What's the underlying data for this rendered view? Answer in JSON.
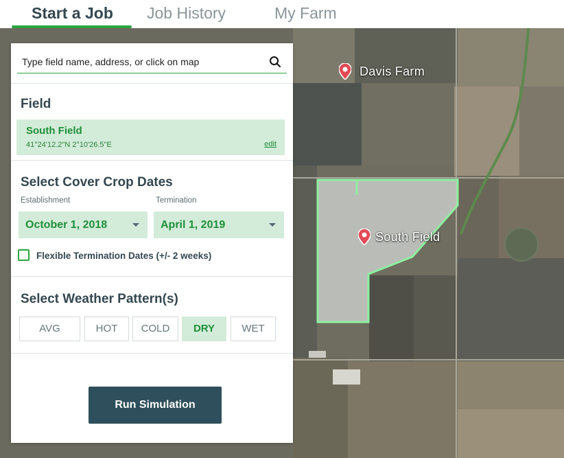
{
  "tabs": [
    {
      "label": "Start a Job",
      "active": true
    },
    {
      "label": "Job History",
      "active": false
    },
    {
      "label": "My Farm",
      "active": false
    }
  ],
  "search": {
    "placeholder": "Type field name, address, or click on map",
    "icon": "search-icon"
  },
  "field_section": {
    "title": "Field",
    "selected": {
      "name": "South Field",
      "coords": "41°24'12.2\"N 2°10'26.5\"E",
      "edit_label": "edit"
    }
  },
  "cover_crop": {
    "title": "Select Cover Crop Dates",
    "establishment_label": "Establishment",
    "establishment_value": "October 1, 2018",
    "termination_label": "Termination",
    "termination_value": "April 1, 2019",
    "flexible_label": "Flexible Termination Dates (+/- 2 weeks)",
    "flexible_checked": false
  },
  "weather": {
    "title": "Select Weather Pattern(s)",
    "options": [
      {
        "label": "AVG",
        "selected": false
      },
      {
        "label": "HOT",
        "selected": false
      },
      {
        "label": "COLD",
        "selected": false
      },
      {
        "label": "DRY",
        "selected": true
      },
      {
        "label": "WET",
        "selected": false
      }
    ]
  },
  "run_button": "Run Simulation",
  "map": {
    "markers": [
      {
        "label": "Davis Farm",
        "icon": "map-pin-icon"
      },
      {
        "label": "South Field",
        "icon": "map-pin-icon"
      }
    ]
  },
  "colors": {
    "accent_green": "#2aa63f",
    "selected_fill": "#d3ecd9",
    "button_dark": "#2f4f5c",
    "field_outline": "#8ef0a0"
  }
}
